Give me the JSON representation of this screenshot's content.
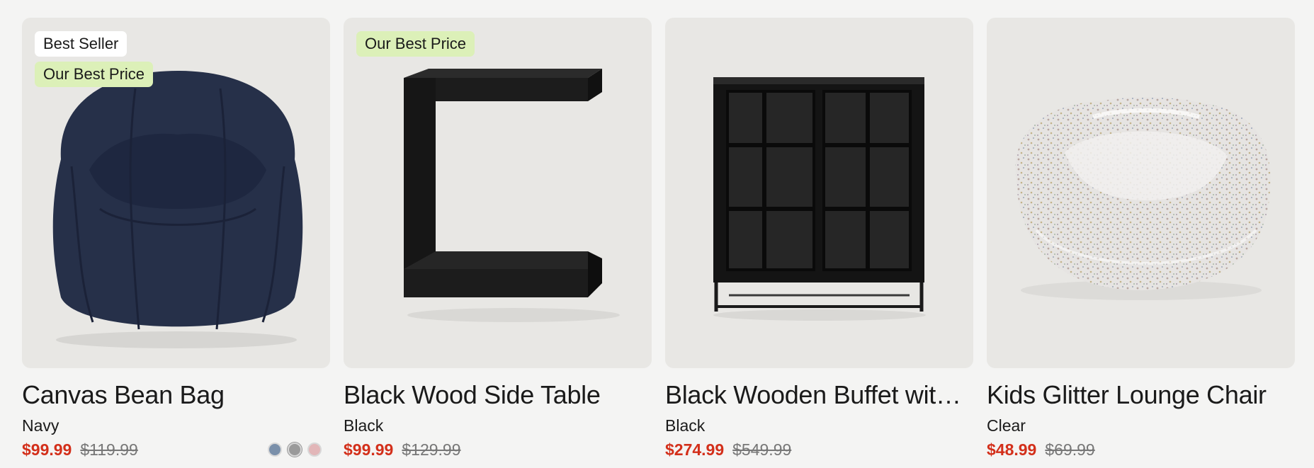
{
  "products": [
    {
      "badges": [
        "Best Seller",
        "Our Best Price"
      ],
      "title": "Canvas Bean Bag",
      "color": "Navy",
      "price": "$99.99",
      "was_price": "$119.99",
      "swatches": [
        {
          "name": "blue-swatch",
          "color": "#7a90aa"
        },
        {
          "name": "gray-swatch",
          "color": "#9a9a9a"
        },
        {
          "name": "pink-swatch",
          "color": "#e2b6b8"
        }
      ]
    },
    {
      "badges": [
        "Our Best Price"
      ],
      "title": "Black Wood Side Table",
      "color": "Black",
      "price": "$99.99",
      "was_price": "$129.99"
    },
    {
      "badges": [],
      "title": "Black Wooden Buffet wit…",
      "color": "Black",
      "price": "$274.99",
      "was_price": "$549.99"
    },
    {
      "badges": [],
      "title": "Kids Glitter Lounge Chair",
      "color": "Clear",
      "price": "$48.99",
      "was_price": "$69.99"
    }
  ],
  "colors": {
    "sale_price": "#d32f1a",
    "badge_green": "#dcf0b8",
    "card_bg": "#e8e7e4"
  }
}
